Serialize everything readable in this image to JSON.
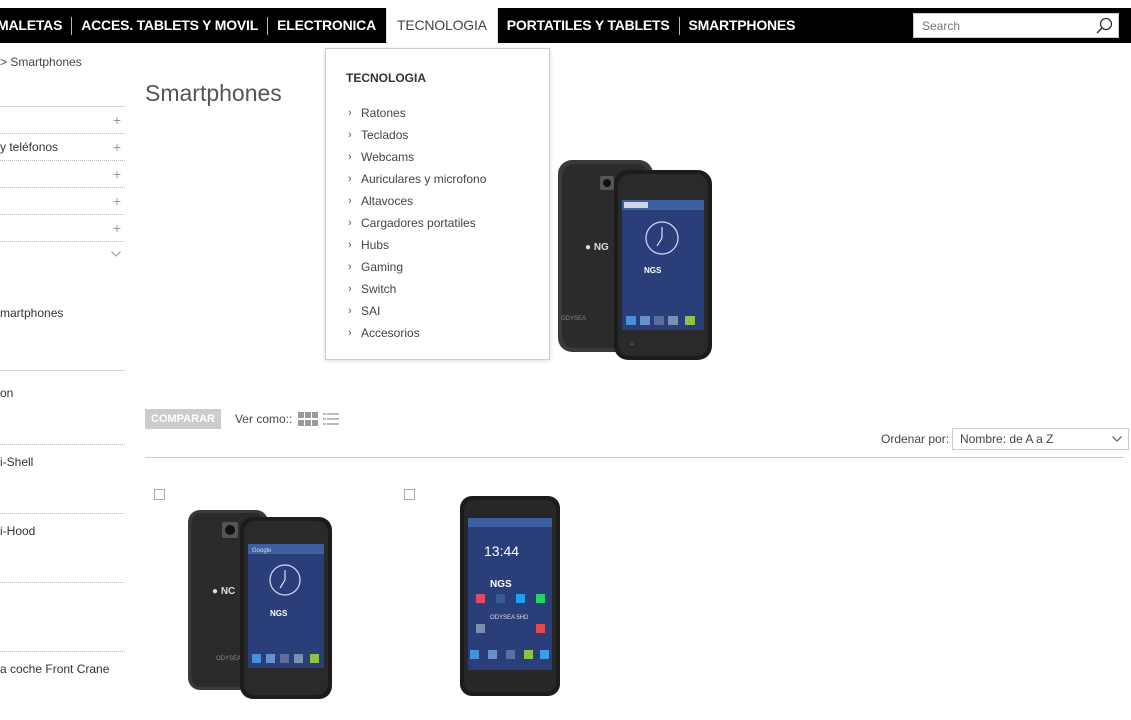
{
  "nav": {
    "items": [
      {
        "label": "MALETAS"
      },
      {
        "label": "ACCES. TABLETS Y MOVIL"
      },
      {
        "label": "ELECTRONICA"
      },
      {
        "label": "TECNOLOGIA"
      },
      {
        "label": "PORTATILES Y TABLETS"
      },
      {
        "label": "SMARTPHONES"
      }
    ],
    "active": "TECNOLOGIA"
  },
  "search": {
    "placeholder": "Search"
  },
  "breadcrumb": "> Smartphones",
  "sidebar": {
    "rows": [
      {
        "label": "",
        "toggle": "+"
      },
      {
        "label": "y teléfonos",
        "toggle": "+"
      },
      {
        "label": "",
        "toggle": "+"
      },
      {
        "label": "",
        "toggle": "+"
      },
      {
        "label": "",
        "toggle": "+"
      }
    ],
    "items": [
      "martphones",
      "on",
      "i-Shell",
      "i-Hood",
      "a coche Front Crane"
    ]
  },
  "page": {
    "title": "Smartphones"
  },
  "toolbar": {
    "compare": "COMPARAR",
    "view_label": "Ver como::"
  },
  "sort": {
    "label": "Ordenar por:",
    "selected": "Nombre: de A a Z"
  },
  "dropdown": {
    "title": "TECNOLOGIA",
    "items": [
      "Ratones",
      "Teclados",
      "Webcams",
      "Auriculares y microfono",
      "Altavoces",
      "Cargadores portatiles",
      "Hubs",
      "Gaming",
      "Switch",
      "SAI",
      "Accesorios"
    ]
  },
  "products": [
    {
      "brand": "NGS",
      "model": "ODYSEA",
      "screen": "Google"
    },
    {
      "brand": "NGS",
      "model": "ODYSEA 5HD",
      "time": "13:44"
    }
  ],
  "colors": {
    "nav_bg": "#000000",
    "compare_bg": "#cccccc",
    "phone_screen": "#2a3f7a"
  }
}
